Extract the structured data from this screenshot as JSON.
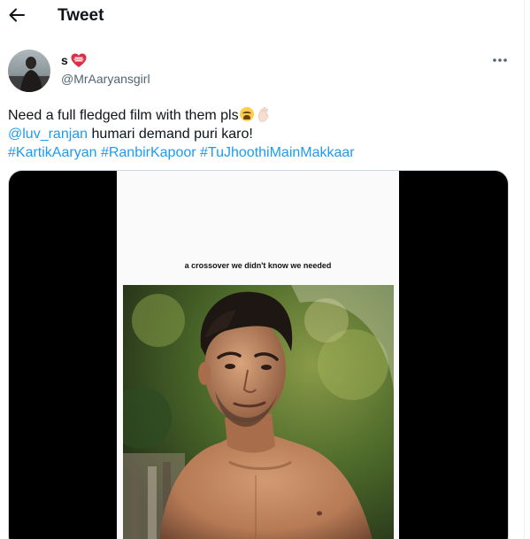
{
  "header": {
    "title": "Tweet",
    "back_icon": "arrow-left-icon"
  },
  "author": {
    "display_name": "s",
    "name_emoji": "heart-with-ribbon-icon",
    "handle": "@MrAaryansgirl",
    "more_icon": "more-horizontal-icon"
  },
  "tweet": {
    "line1_text": "Need a full fledged film with them pls",
    "line1_emojis": [
      "weary-face-emoji",
      "pinching-hand-emoji"
    ],
    "mention": "@luv_ranjan",
    "line2_text": " humari demand puri karo!",
    "hashtags": [
      "#KartikAaryan",
      "#RanbirKapoor",
      "#TuJhoothiMainMakkaar"
    ]
  },
  "media": {
    "caption": "a crossover we didn't know we needed"
  },
  "colors": {
    "link": "#1d9bf0",
    "secondary_text": "#536471",
    "border": "#cfd9de"
  }
}
